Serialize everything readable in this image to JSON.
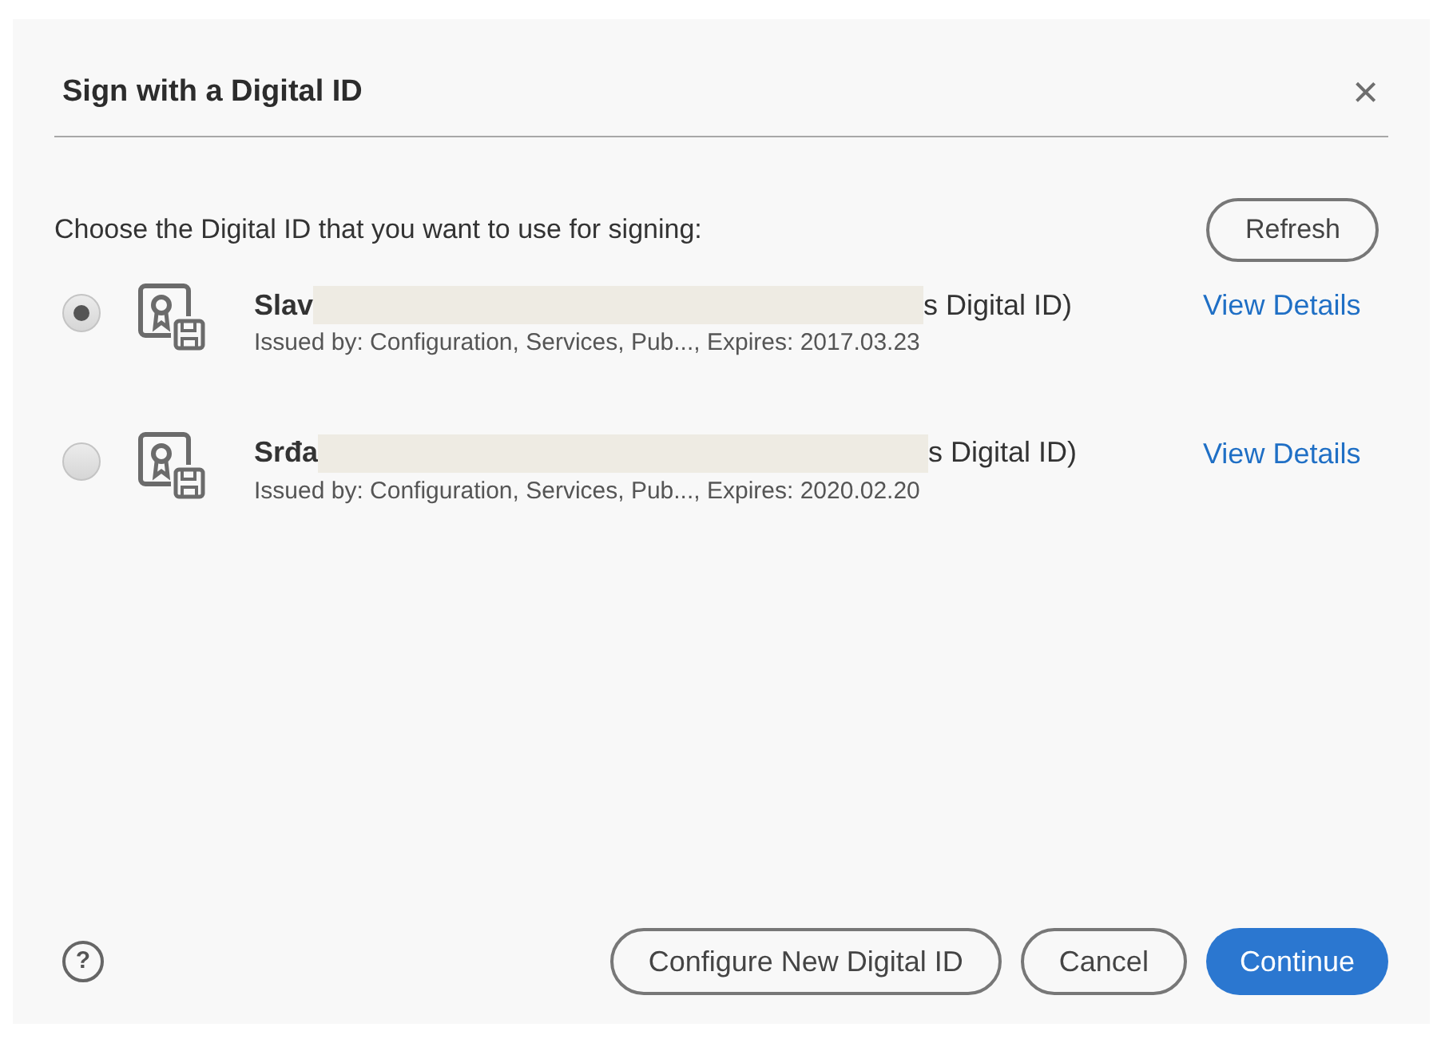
{
  "dialog": {
    "title": "Sign with a Digital ID",
    "close": "×"
  },
  "prompt": "Choose the Digital ID that you want to use for signing:",
  "refresh": "Refresh",
  "ids": [
    {
      "name_start": "Slav",
      "name_end": "s Digital ID)",
      "issued": "Issued by: Configuration, Services, Pub..., Expires: 2017.03.23",
      "details": "View Details",
      "selected": true
    },
    {
      "name_start": "Srđa",
      "name_end": "s Digital ID)",
      "issued": "Issued by: Configuration, Services, Pub..., Expires: 2020.02.20",
      "details": "View Details",
      "selected": false
    }
  ],
  "footer": {
    "help": "?",
    "buttons": [
      {
        "label": "Configure New Digital ID",
        "kind": "outline"
      },
      {
        "label": "Cancel",
        "kind": "outline"
      },
      {
        "label": "Continue",
        "kind": "primary"
      }
    ]
  }
}
